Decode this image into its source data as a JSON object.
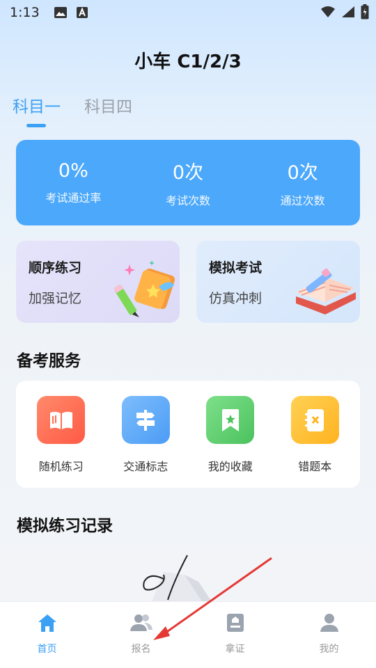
{
  "status_bar": {
    "time": "1:13"
  },
  "header": {
    "title": "小车 C1/2/3"
  },
  "tabs": [
    {
      "label": "科目一",
      "active": true
    },
    {
      "label": "科目四",
      "active": false
    }
  ],
  "stats": [
    {
      "value": "0%",
      "label": "考试通过率"
    },
    {
      "value": "0次",
      "label": "考试次数"
    },
    {
      "value": "0次",
      "label": "通过次数"
    }
  ],
  "practice_cards": {
    "sequential": {
      "title": "顺序练习",
      "subtitle": "加强记忆",
      "icon": "book-pencil-icon"
    },
    "mock_exam": {
      "title": "模拟考试",
      "subtitle": "仿真冲刺",
      "icon": "open-book-icon"
    }
  },
  "services": {
    "title": "备考服务",
    "items": [
      {
        "label": "随机练习",
        "icon": "book-icon",
        "color": "#ff6b4f"
      },
      {
        "label": "交通标志",
        "icon": "signpost-icon",
        "color": "#5aa7f7"
      },
      {
        "label": "我的收藏",
        "icon": "bookmark-star-icon",
        "color": "#5fcf6e"
      },
      {
        "label": "错题本",
        "icon": "notebook-x-icon",
        "color": "#ffc233"
      }
    ]
  },
  "records": {
    "title": "模拟练习记录"
  },
  "bottom_nav": [
    {
      "label": "首页",
      "icon": "home-icon",
      "active": true
    },
    {
      "label": "报名",
      "icon": "users-icon",
      "active": false
    },
    {
      "label": "拿证",
      "icon": "certificate-icon",
      "active": false
    },
    {
      "label": "我的",
      "icon": "user-icon",
      "active": false
    }
  ],
  "colors": {
    "accent": "#3ca0f5",
    "stats_bg": "#4ba8fb",
    "annotation_arrow": "#e53935"
  }
}
